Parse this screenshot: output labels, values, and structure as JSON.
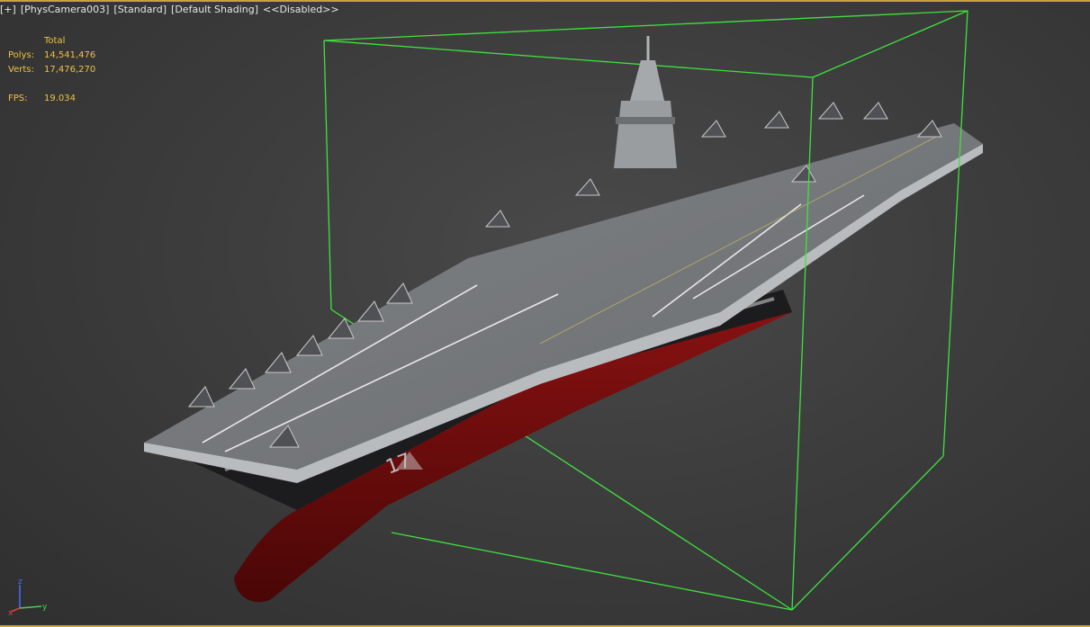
{
  "viewport": {
    "labels": [
      "[+]",
      "[PhysCamera003]",
      "[Standard]",
      "[Default Shading]",
      "<<Disabled>>"
    ]
  },
  "stats": {
    "header": "Total",
    "polys_label": "Polys:",
    "polys_value": "14,541,476",
    "verts_label": "Verts:",
    "verts_value": "17,476,270",
    "fps_label": "FPS:",
    "fps_value": "19.034"
  },
  "hull": {
    "number": "17"
  },
  "gizmo": {
    "z": "z",
    "x": "x",
    "y": "y"
  },
  "colors": {
    "bounding_box": "#3fe23f",
    "stats_text": "#f0c240",
    "hull_red": "#7a0d0d",
    "deck_gray": "#777a7d",
    "border_accent": "#c9a23a"
  }
}
